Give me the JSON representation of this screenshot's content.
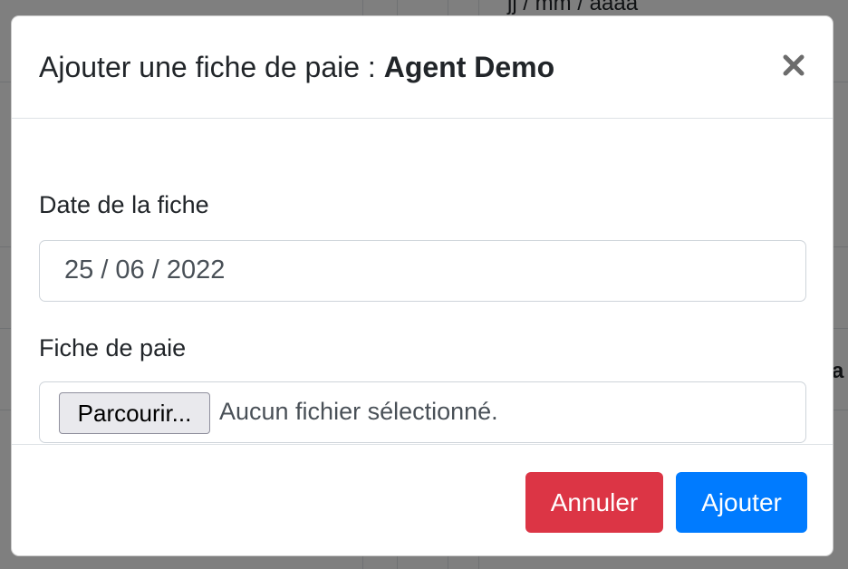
{
  "background": {
    "partial_text_top": "jj / mm / aaaa",
    "partial_text_right": "a"
  },
  "modal": {
    "title_prefix": "Ajouter une fiche de paie : ",
    "title_agent": "Agent Demo",
    "close_icon": "close-icon"
  },
  "form": {
    "date_label": "Date de la fiche",
    "date_value": "25 / 06 / 2022",
    "file_label": "Fiche de paie",
    "browse_label": "Parcourir...",
    "no_file_text": "Aucun fichier sélectionné."
  },
  "footer": {
    "cancel_label": "Annuler",
    "submit_label": "Ajouter"
  },
  "colors": {
    "cancel": "#dc3545",
    "submit": "#007bff",
    "text": "#212529"
  }
}
